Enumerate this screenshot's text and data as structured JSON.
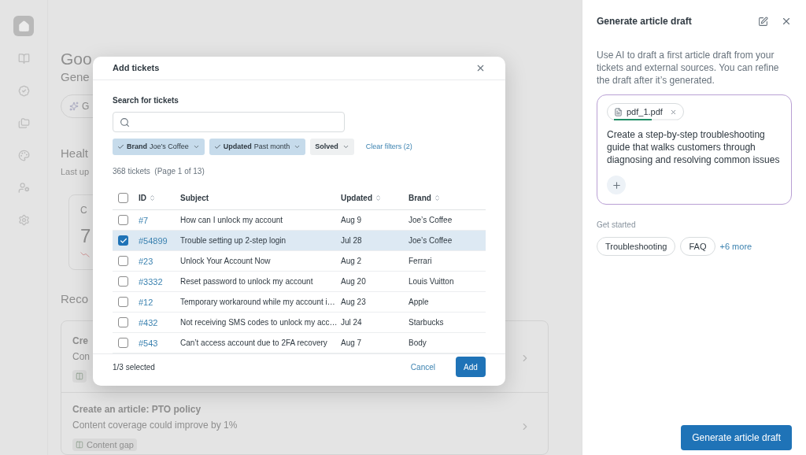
{
  "sidebar": {
    "items": [
      {
        "selected": true
      },
      {
        "selected": false
      },
      {
        "selected": false
      },
      {
        "selected": false
      },
      {
        "selected": false
      },
      {
        "selected": false
      },
      {
        "selected": false
      }
    ]
  },
  "background": {
    "greeting": "Goo",
    "subtitle": "Gene",
    "generate_button": "G",
    "health": {
      "title": "Healt",
      "updated": "Last up",
      "card": {
        "label": "C",
        "value": "7"
      }
    },
    "recommendations": {
      "title": "Reco",
      "items": [
        {
          "title": "Cre",
          "description": "Con"
        },
        {
          "title": "Create an article: PTO policy",
          "description": "Content coverage could improve by 1%",
          "tag": "Content gap"
        }
      ]
    }
  },
  "modal": {
    "title": "Add tickets",
    "search": {
      "label": "Search for tickets"
    },
    "filters": [
      {
        "label": "Brand",
        "value": "Joe’s Coffee",
        "selected": true
      },
      {
        "label": "Updated",
        "value": "Past month",
        "selected": true
      },
      {
        "label": "Solved",
        "selected": false
      }
    ],
    "clear_filters": "Clear filters (2)",
    "count": "368 tickets",
    "page": "(Page 1 of 13)",
    "table": {
      "all_checked": false,
      "columns": [
        {
          "label": "ID",
          "sortable": true
        },
        {
          "label": "Subject",
          "sortable": false
        },
        {
          "label": "Updated",
          "sortable": true
        },
        {
          "label": "Brand",
          "sortable": true
        }
      ],
      "rows": [
        {
          "id": "#7",
          "subject": "How can I unlock my account",
          "updated": "Aug 9",
          "brand": "Joe’s Coffee",
          "selected": false
        },
        {
          "id": "#54899",
          "subject": "Trouble setting up 2-step login",
          "updated": "Jul 28",
          "brand": "Joe’s Coffee",
          "selected": true
        },
        {
          "id": "#23",
          "subject": "Unlock Your Account Now",
          "updated": "Aug 2",
          "brand": "Ferrari",
          "selected": false
        },
        {
          "id": "#3332",
          "subject": "Reset password to unlock my account",
          "updated": "Aug 20",
          "brand": "Louis Vuitton",
          "selected": false
        },
        {
          "id": "#12",
          "subject": "Temporary workaround while my account i…",
          "updated": "Aug 23",
          "brand": "Apple",
          "selected": false
        },
        {
          "id": "#432",
          "subject": "Not receiving SMS codes to unlock my acc…",
          "updated": "Jul 24",
          "brand": "Starbucks",
          "selected": false
        },
        {
          "id": "#543",
          "subject": "Can’t access account due to 2FA recovery",
          "updated": "Aug 7",
          "brand": "Body",
          "selected": false
        }
      ]
    },
    "footer": {
      "selection": "1/3 selected",
      "cancel": "Cancel",
      "confirm": "Add"
    }
  },
  "panel": {
    "title": "Generate article draft",
    "description": "Use AI to draft a first article draft from your tickets and external sources. You can refine the draft after it’s generated.",
    "attachment": {
      "name": "pdf_1.pdf",
      "level": 0.6
    },
    "prompt": "Create a step-by-step troubleshooting guide that walks customers through diagnosing and resolving common issues",
    "get_started": "Get started",
    "suggestions": [
      "Troubleshooting",
      "FAQ"
    ],
    "more": "+6 more",
    "generate": "Generate article draft"
  }
}
